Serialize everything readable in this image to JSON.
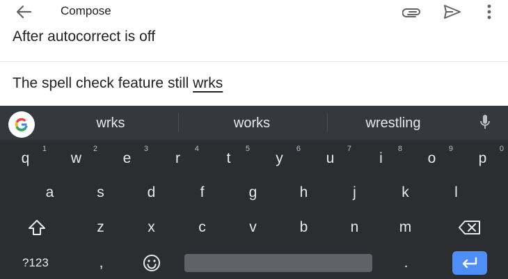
{
  "app_bar": {
    "title": "Compose",
    "icons": [
      "back-arrow-icon",
      "paperclip-icon",
      "send-icon",
      "more-vert-icon"
    ]
  },
  "compose": {
    "subject": "After autocorrect is off",
    "body_prefix": "The spell check feature still ",
    "body_misspelled_word": "wrks"
  },
  "keyboard": {
    "suggestions": [
      "wrks",
      "works",
      "wrestling"
    ],
    "row1": [
      {
        "label": "q",
        "hint": "1"
      },
      {
        "label": "w",
        "hint": "2"
      },
      {
        "label": "e",
        "hint": "3"
      },
      {
        "label": "r",
        "hint": "4"
      },
      {
        "label": "t",
        "hint": "5"
      },
      {
        "label": "y",
        "hint": "6"
      },
      {
        "label": "u",
        "hint": "7"
      },
      {
        "label": "i",
        "hint": "8"
      },
      {
        "label": "o",
        "hint": "9"
      },
      {
        "label": "p",
        "hint": "0"
      }
    ],
    "row2": [
      "a",
      "s",
      "d",
      "f",
      "g",
      "h",
      "j",
      "k",
      "l"
    ],
    "row3": [
      "z",
      "x",
      "c",
      "v",
      "b",
      "n",
      "m"
    ],
    "bottom": {
      "symbols_label": "?123",
      "comma": ",",
      "period": "."
    },
    "colors": {
      "background": "#2b2d30",
      "suggestion_bar": "#35383c",
      "enter_key": "#4f8ef7",
      "space_key": "#5f6368"
    }
  }
}
